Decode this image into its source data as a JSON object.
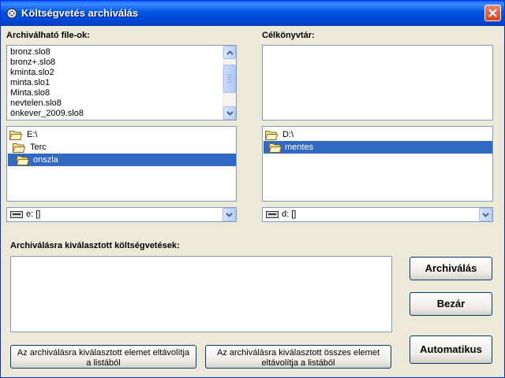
{
  "window": {
    "title": "Költségvetés archiválás"
  },
  "source": {
    "label": "Archiválható file-ok:",
    "files": [
      "bronz.slo8",
      "bronz+.slo8",
      "kminta.slo2",
      "minta.slo1",
      "Minta.slo8",
      "nevtelen.slo8",
      "önkever_2009.slo8"
    ],
    "folders": [
      "E:\\",
      "Terc",
      "onszla"
    ],
    "selected_folder": "onszla",
    "drive": "e: []"
  },
  "target": {
    "label": "Célkönyvtár:",
    "folders": [
      "D:\\",
      "mentes"
    ],
    "selected_folder": "mentes",
    "drive": "d: []"
  },
  "selected_list": {
    "label": "Archiválásra kiválasztott költségvetések:"
  },
  "buttons": {
    "archive": "Archiválás",
    "close": "Bezár",
    "auto": "Automatikus",
    "remove_one": "Az archiválásra kiválasztott elemet eltávolítja a listából",
    "remove_all": "Az archiválásra kiválasztott összes elemet eltávolítja a listából"
  },
  "icons": {
    "app": "archive-app-icon",
    "close": "close-icon",
    "folder": "folder-open-icon",
    "drive": "drive-icon",
    "scroll_up": "chevron-up-icon",
    "scroll_down": "chevron-down-icon",
    "dropdown": "chevron-down-icon"
  },
  "colors": {
    "selection": "#316ac5",
    "title_bar": "#0054e3",
    "window_bg": "#ece9d8"
  }
}
